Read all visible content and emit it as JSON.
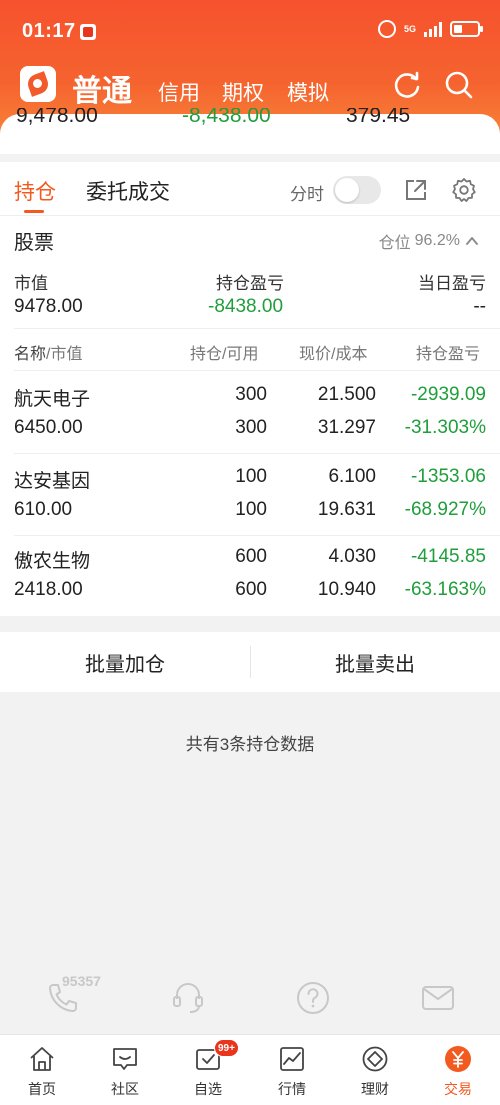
{
  "status_bar": {
    "time": "01:17",
    "network": "5G"
  },
  "header": {
    "title": "普通",
    "tabs": [
      "信用",
      "期权",
      "模拟"
    ]
  },
  "summary_strip": {
    "market_value": "9,478.00",
    "holding_pl": "-8,438.00",
    "other": "379.45"
  },
  "tabs": {
    "positions": "持仓",
    "orders": "委托成交",
    "toggle_label": "分时"
  },
  "stocks_section": {
    "title": "股票",
    "ratio_label": "仓位",
    "ratio_value": "96.2%",
    "market_value_label": "市值",
    "market_value": "9478.00",
    "holding_pl_label": "持仓盈亏",
    "holding_pl": "-8438.00",
    "daily_pl_label": "当日盈亏",
    "daily_pl": "--"
  },
  "table": {
    "headers": {
      "name": "名称",
      "name_sub": "/市值",
      "pos": "持仓",
      "pos_sub": "/可用",
      "price": "现价",
      "price_sub": "/成本",
      "pl": "持仓盈亏"
    },
    "rows": [
      {
        "name": "航天电子",
        "mv": "6450.00",
        "pos": "300",
        "avail": "300",
        "price": "21.500",
        "cost": "31.297",
        "pl": "-2939.09",
        "pl_pct": "-31.303%"
      },
      {
        "name": "达安基因",
        "mv": "610.00",
        "pos": "100",
        "avail": "100",
        "price": "6.100",
        "cost": "19.631",
        "pl": "-1353.06",
        "pl_pct": "-68.927%"
      },
      {
        "name": "傲农生物",
        "mv": "2418.00",
        "pos": "600",
        "avail": "600",
        "price": "4.030",
        "cost": "10.940",
        "pl": "-4145.85",
        "pl_pct": "-63.163%"
      }
    ]
  },
  "batch": {
    "add": "批量加仓",
    "sell": "批量卖出"
  },
  "count_note": "共有3条持仓数据",
  "service": {
    "hotline": "95357"
  },
  "bottom_nav": [
    {
      "label": "首页",
      "icon": "home-icon"
    },
    {
      "label": "社区",
      "icon": "community-icon"
    },
    {
      "label": "自选",
      "icon": "watchlist-icon",
      "badge": "99+"
    },
    {
      "label": "行情",
      "icon": "market-icon"
    },
    {
      "label": "理财",
      "icon": "wealth-icon"
    },
    {
      "label": "交易",
      "icon": "trade-icon"
    }
  ],
  "colors": {
    "brand": "#f35a1f",
    "loss": "#1f9e3b"
  }
}
